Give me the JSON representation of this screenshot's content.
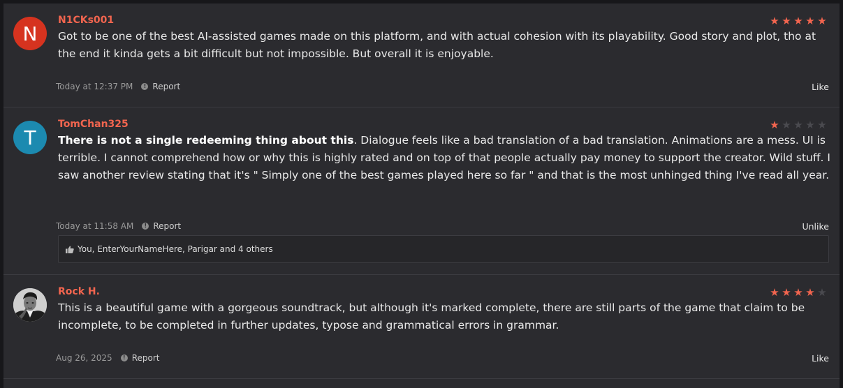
{
  "reviews": [
    {
      "avatar_letter": "N",
      "avatar_color": "#d6331f",
      "username": "N1CKs001",
      "rating": 5,
      "bold_text": "",
      "text": "Got to be one of the best AI-assisted games made on this platform, and with actual cohesion with its playability. Good story and plot, tho at the end it kinda gets a bit difficult but not impossible. But overall it is enjoyable.",
      "time": "Today at 12:37 PM",
      "report_label": "Report",
      "action_label": "Like"
    },
    {
      "avatar_letter": "T",
      "avatar_color": "#1c8ab0",
      "username": "TomChan325",
      "rating": 1,
      "bold_text": "There is not a single redeeming thing about this",
      "text": ". Dialogue feels like a bad translation of a bad translation. Animations are a mess. UI is terrible. I cannot comprehend how or why this is highly rated and on top of that people actually pay money to support the creator. Wild stuff. I saw another review stating that it's \" Simply one of the best games played here so far \" and that is the most unhinged thing I've read all year.",
      "time": "Today at 11:58 AM",
      "report_label": "Report",
      "action_label": "Unlike",
      "likes_text": "You, EnterYourNameHere, Parigar and 4 others"
    },
    {
      "avatar_letter": "",
      "avatar_color": "#d8d8d8",
      "username": "Rock H.",
      "rating": 4,
      "bold_text": "",
      "text": "This is a beautiful game with a gorgeous soundtrack, but although it's marked complete, there are still parts of the game that claim to be incomplete, to be completed in further updates, typose and grammatical errors in grammar.",
      "time": "Aug 26, 2025",
      "report_label": "Report",
      "action_label": "Like"
    }
  ],
  "colors": {
    "accent": "#f2654f",
    "background": "#2b2b2f"
  }
}
